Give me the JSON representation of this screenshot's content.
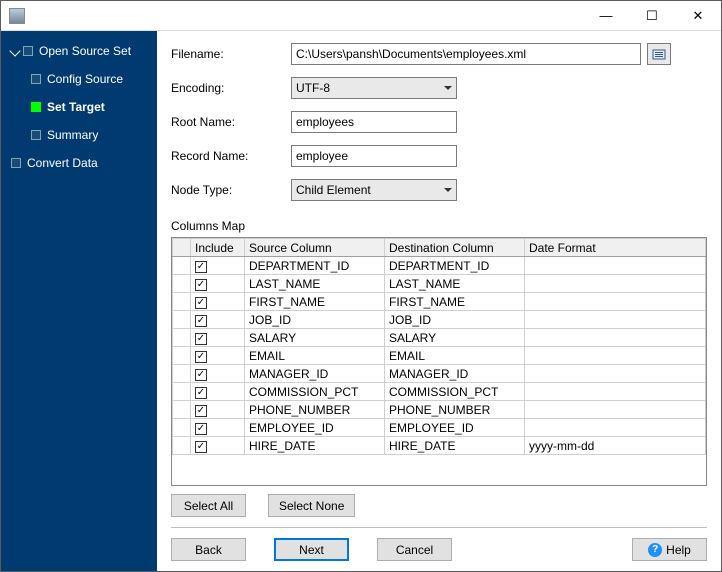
{
  "titlebar": {
    "minimize": "—",
    "maximize": "☐",
    "close": "✕"
  },
  "sidebar": {
    "items": [
      {
        "label": "Open Source Set",
        "level": 0,
        "active": false,
        "expanded": true
      },
      {
        "label": "Config Source",
        "level": 1,
        "active": false
      },
      {
        "label": "Set Target",
        "level": 1,
        "active": true
      },
      {
        "label": "Summary",
        "level": 1,
        "active": false
      },
      {
        "label": "Convert Data",
        "level": 0,
        "active": false
      }
    ]
  },
  "form": {
    "filename_label": "Filename:",
    "filename_value": "C:\\Users\\pansh\\Documents\\employees.xml",
    "encoding_label": "Encoding:",
    "encoding_value": "UTF-8",
    "root_label": "Root Name:",
    "root_value": "employees",
    "record_label": "Record Name:",
    "record_value": "employee",
    "nodetype_label": "Node Type:",
    "nodetype_value": "Child Element"
  },
  "columns_map": {
    "heading": "Columns Map",
    "headers": {
      "include": "Include",
      "source": "Source Column",
      "destination": "Destination Column",
      "date_format": "Date Format"
    },
    "rows": [
      {
        "include": true,
        "source": "DEPARTMENT_ID",
        "destination": "DEPARTMENT_ID",
        "date_format": ""
      },
      {
        "include": true,
        "source": "LAST_NAME",
        "destination": "LAST_NAME",
        "date_format": ""
      },
      {
        "include": true,
        "source": "FIRST_NAME",
        "destination": "FIRST_NAME",
        "date_format": ""
      },
      {
        "include": true,
        "source": "JOB_ID",
        "destination": "JOB_ID",
        "date_format": ""
      },
      {
        "include": true,
        "source": "SALARY",
        "destination": "SALARY",
        "date_format": ""
      },
      {
        "include": true,
        "source": "EMAIL",
        "destination": "EMAIL",
        "date_format": ""
      },
      {
        "include": true,
        "source": "MANAGER_ID",
        "destination": "MANAGER_ID",
        "date_format": ""
      },
      {
        "include": true,
        "source": "COMMISSION_PCT",
        "destination": "COMMISSION_PCT",
        "date_format": ""
      },
      {
        "include": true,
        "source": "PHONE_NUMBER",
        "destination": "PHONE_NUMBER",
        "date_format": ""
      },
      {
        "include": true,
        "source": "EMPLOYEE_ID",
        "destination": "EMPLOYEE_ID",
        "date_format": ""
      },
      {
        "include": true,
        "source": "HIRE_DATE",
        "destination": "HIRE_DATE",
        "date_format": "yyyy-mm-dd"
      }
    ]
  },
  "buttons": {
    "select_all": "Select All",
    "select_none": "Select None",
    "back": "Back",
    "next": "Next",
    "cancel": "Cancel",
    "help": "Help"
  }
}
